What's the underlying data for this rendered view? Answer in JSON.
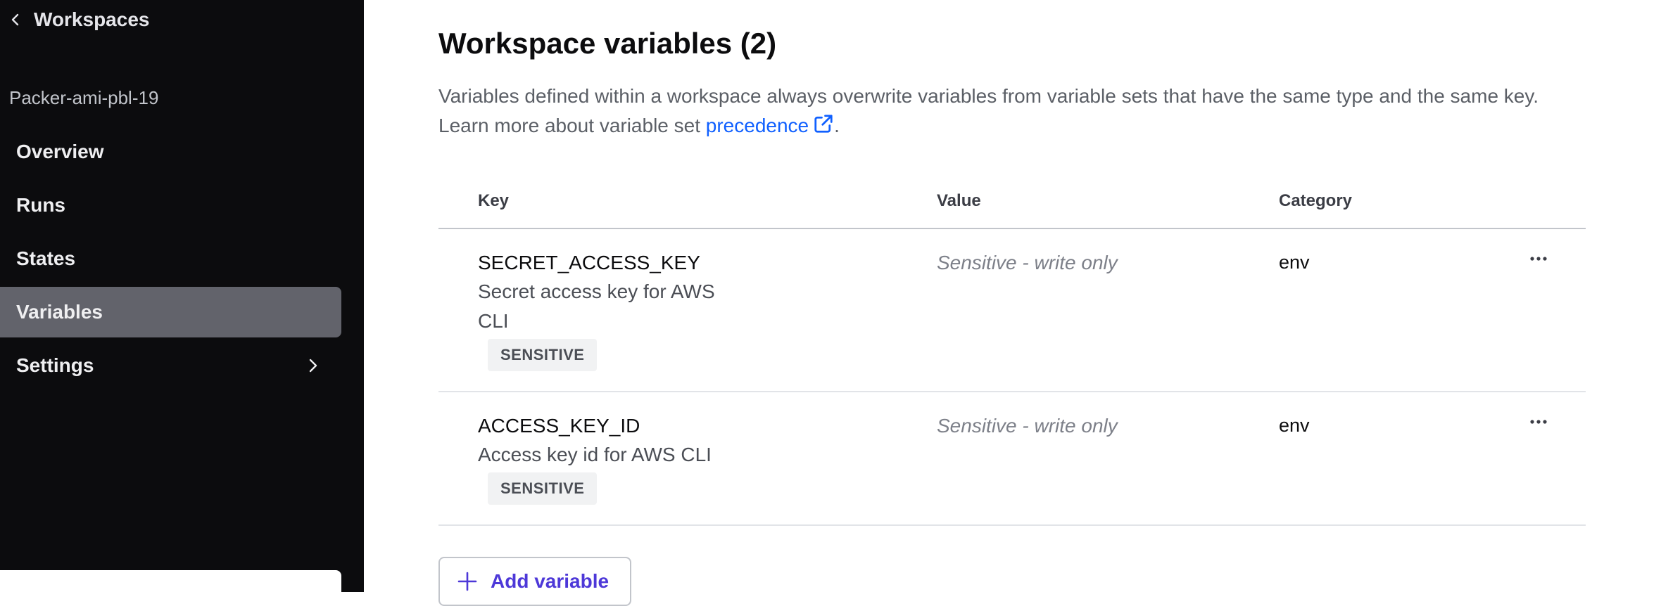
{
  "sidebar": {
    "back_label": "Workspaces",
    "workspace_name": "Packer-ami-pbl-19",
    "items": [
      {
        "label": "Overview"
      },
      {
        "label": "Runs"
      },
      {
        "label": "States"
      },
      {
        "label": "Variables",
        "active": true
      },
      {
        "label": "Settings",
        "has_submenu": true
      }
    ]
  },
  "main": {
    "title": "Workspace variables (2)",
    "description_before_link": "Variables defined within a workspace always overwrite variables from variable sets that have the same type and the same key. Learn more about variable set ",
    "description_link": "precedence",
    "description_after_link": ".",
    "table": {
      "headers": {
        "key": "Key",
        "value": "Value",
        "category": "Category"
      },
      "rows": [
        {
          "key": "SECRET_ACCESS_KEY",
          "description": "Secret access key for AWS CLI",
          "badge": "SENSITIVE",
          "value": "Sensitive - write only",
          "category": "env"
        },
        {
          "key": "ACCESS_KEY_ID",
          "description": "Access key id for AWS CLI",
          "badge": "SENSITIVE",
          "value": "Sensitive - write only",
          "category": "env"
        }
      ]
    },
    "add_button_label": "Add variable"
  },
  "colors": {
    "sidebar_bg": "#0c0c0e",
    "active_item_bg": "#62636b",
    "link": "#1060ff",
    "primary_button_text": "#4d38d8"
  },
  "icons": {
    "back": "chevron-left-icon",
    "submenu": "chevron-right-icon",
    "external_link": "external-link-icon",
    "row_menu": "ellipsis-icon",
    "add": "plus-icon"
  }
}
